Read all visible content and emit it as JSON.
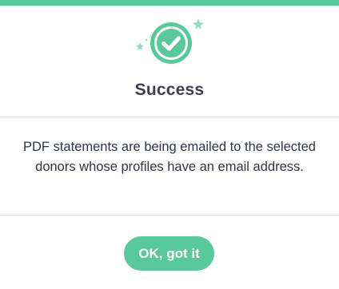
{
  "colors": {
    "accent": "#57c99a",
    "accent_light": "#9bddc0",
    "text": "#2f3542",
    "divider": "#e3e5e8"
  },
  "dialog": {
    "title": "Success",
    "icon": "checkmark-circle-icon",
    "message": "PDF statements are being emailed to the selected donors whose profiles have an email address.",
    "ok_button_label": "OK, got it"
  }
}
